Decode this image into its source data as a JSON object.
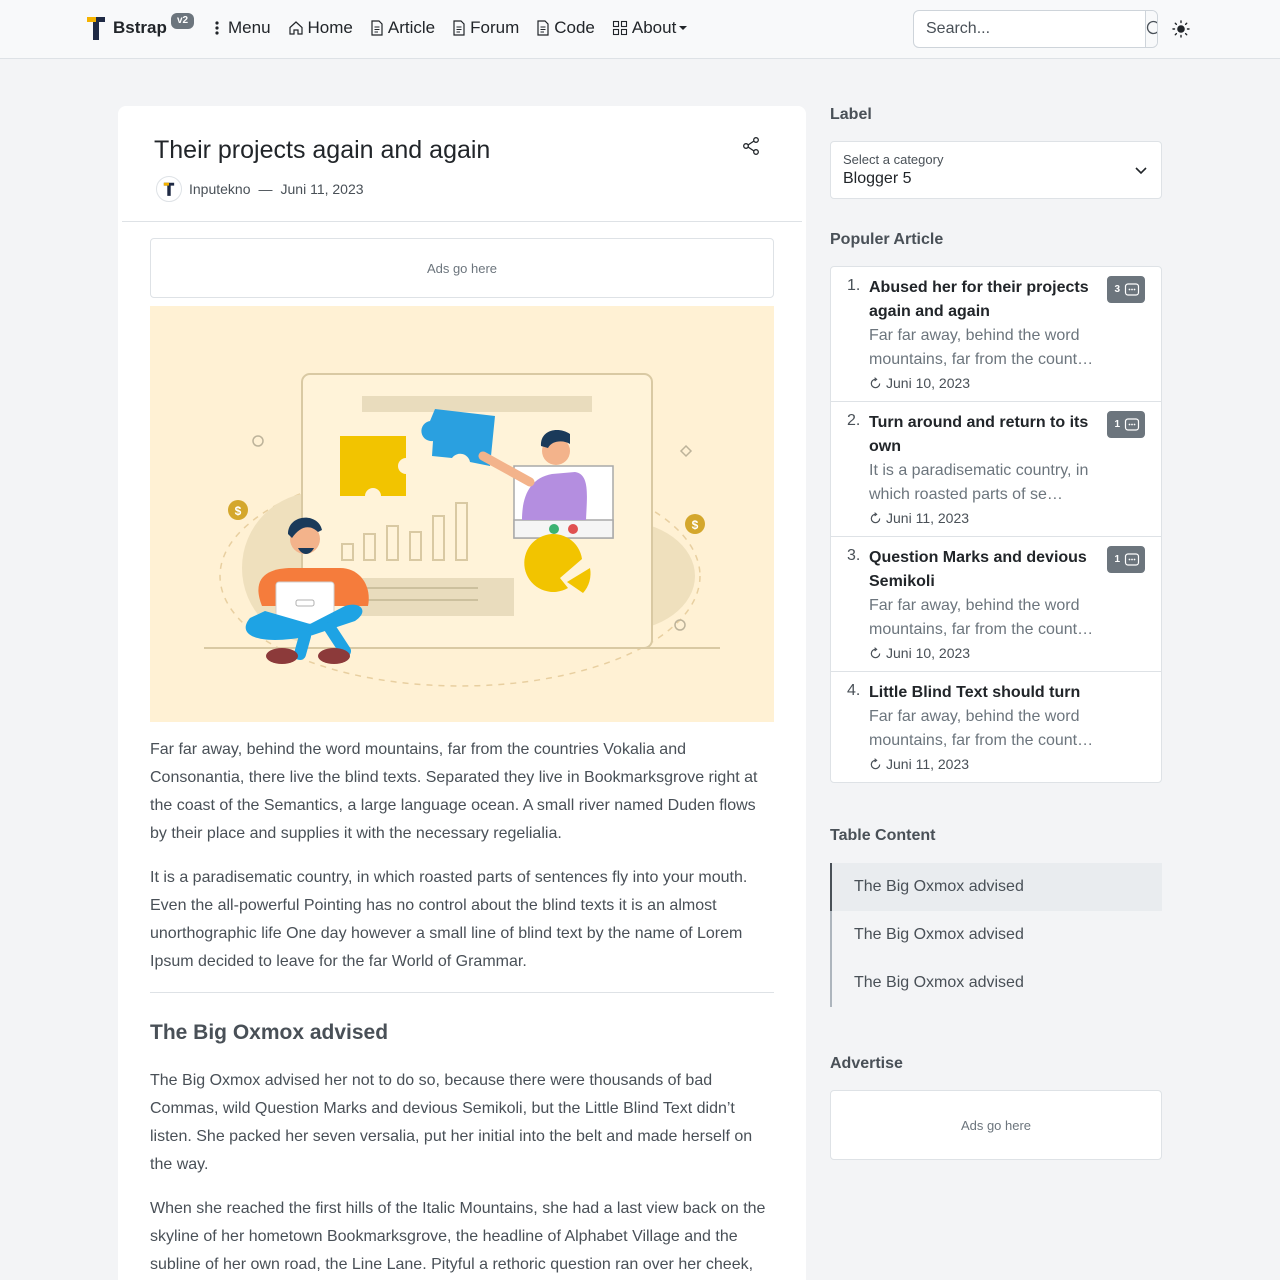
{
  "navbar": {
    "brand_name": "Bstrap",
    "brand_badge": "v2",
    "menu_label": "Menu",
    "items": [
      {
        "label": "Home",
        "icon": "home-icon"
      },
      {
        "label": "Article",
        "icon": "document-icon"
      },
      {
        "label": "Forum",
        "icon": "document-icon"
      },
      {
        "label": "Code",
        "icon": "document-icon"
      },
      {
        "label": "About",
        "icon": "grid-icon"
      }
    ],
    "search_placeholder": "Search..."
  },
  "post": {
    "title": "Their projects again and again",
    "author": "Inputekno",
    "separator": "—",
    "date": "Juni 11, 2023",
    "ad_text": "Ads go here",
    "paragraphs": [
      "Far far away, behind the word mountains, far from the countries Vokalia and Consonantia, there live the blind texts. Separated they live in Bookmarksgrove right at the coast of the Semantics, a large language ocean. A small river named Duden flows by their place and supplies it with the necessary regelialia.",
      "It is a paradisematic country, in which roasted parts of sentences fly into your mouth. Even the all-powerful Pointing has no control about the blind texts it is an almost unorthographic life One day however a small line of blind text by the name of Lorem Ipsum decided to leave for the far World of Grammar."
    ],
    "section_heading": "The Big Oxmox advised",
    "section_paragraphs": [
      "The Big Oxmox advised her not to do so, because there were thousands of bad Commas, wild Question Marks and devious Semikoli, but the Little Blind Text didn’t listen. She packed her seven versalia, put her initial into the belt and made herself on the way.",
      "When she reached the first hills of the Italic Mountains, she had a last view back on the skyline of her hometown Bookmarksgrove, the headline of Alphabet Village and the subline of her own road, the Line Lane. Pityful a rethoric question ran over her cheek, then"
    ]
  },
  "sidebar": {
    "label_heading": "Label",
    "select_label": "Select a category",
    "select_value": "Blogger 5",
    "popular_heading": "Populer Article",
    "popular": [
      {
        "num": "1.",
        "title": "Abused her for their projects again and again",
        "excerpt": "Far far away, behind the word mountains, far from the count…",
        "date": "Juni 10, 2023",
        "comments": "3"
      },
      {
        "num": "2.",
        "title": "Turn around and return to its own",
        "excerpt": "It is a paradisematic country, in which roasted parts of se…",
        "date": "Juni 11, 2023",
        "comments": "1"
      },
      {
        "num": "3.",
        "title": "Question Marks and devious Semikoli",
        "excerpt": "Far far away, behind the word mountains, far from the count…",
        "date": "Juni 10, 2023",
        "comments": "1"
      },
      {
        "num": "4.",
        "title": "Little Blind Text should turn",
        "excerpt": "Far far away, behind the word mountains, far from the count…",
        "date": "Juni 11, 2023",
        "comments": ""
      }
    ],
    "toc_heading": "Table Content",
    "toc": [
      "The Big Oxmox advised",
      "The Big Oxmox advised",
      "The Big Oxmox advised"
    ],
    "advertise_heading": "Advertise",
    "advertise_text": "Ads go here"
  }
}
